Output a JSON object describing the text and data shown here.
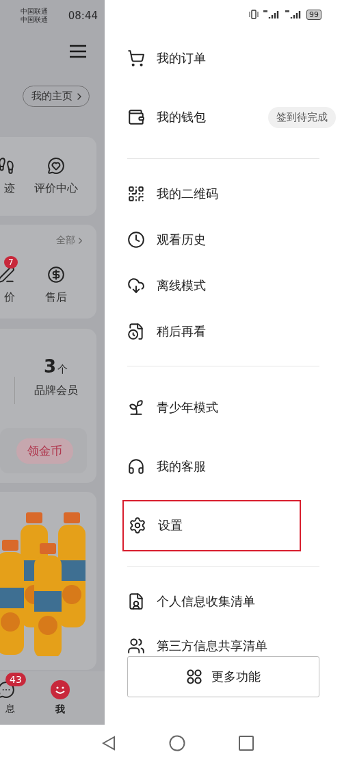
{
  "status_bar": {
    "carriers": [
      "中国联通",
      "中国联通"
    ],
    "time": "08:44",
    "battery": "99"
  },
  "background_page": {
    "profile_link": "我的主页",
    "shortcuts": [
      {
        "label": "迹"
      },
      {
        "label": "评价中心"
      }
    ],
    "orders": {
      "all_link": "全部",
      "items": [
        {
          "label": "价",
          "badge": "7"
        },
        {
          "label": "售后"
        }
      ]
    },
    "membership": {
      "count": "3",
      "unit": "个",
      "label": "品牌会员",
      "coin_button": "领金币"
    },
    "tab_bar": [
      {
        "label": "息",
        "badge": "43",
        "selected": false
      },
      {
        "label": "我",
        "selected": true
      }
    ]
  },
  "drawer": {
    "groups": [
      {
        "items": [
          {
            "label": "我的订单",
            "highlighted": false
          },
          {
            "label": "我的钱包",
            "tag": "签到待完成",
            "highlighted": false
          }
        ]
      },
      {
        "items": [
          {
            "label": "我的二维码",
            "highlighted": false
          },
          {
            "label": "观看历史",
            "highlighted": false
          },
          {
            "label": "离线模式",
            "highlighted": false
          },
          {
            "label": "稍后再看",
            "highlighted": false
          }
        ]
      },
      {
        "items": [
          {
            "label": "青少年模式",
            "highlighted": false
          },
          {
            "label": "我的客服",
            "highlighted": false
          },
          {
            "label": "设置",
            "highlighted": true
          }
        ]
      },
      {
        "items": [
          {
            "label": "个人信息收集清单",
            "highlighted": false
          },
          {
            "label": "第三方信息共享清单",
            "highlighted": false
          }
        ]
      }
    ],
    "more_button": "更多功能"
  }
}
